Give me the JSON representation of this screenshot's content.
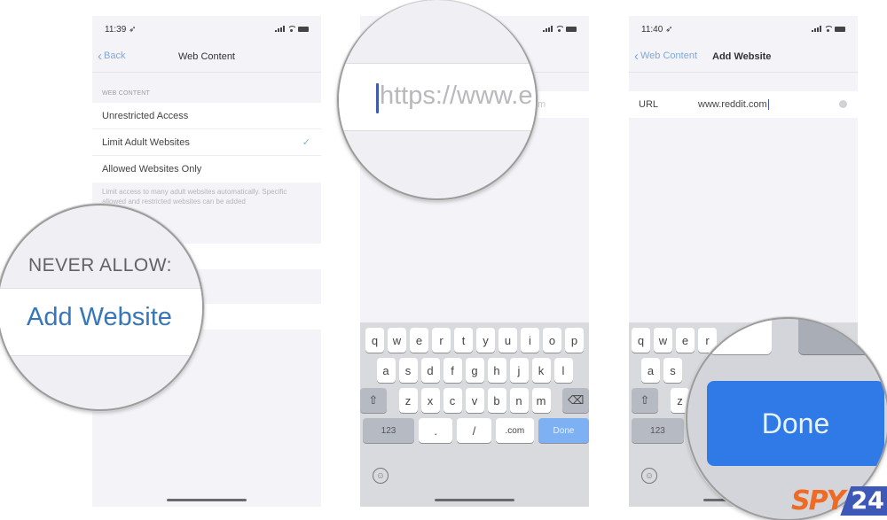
{
  "screens": [
    {
      "status": {
        "time": "11:39",
        "location_icon": "location-arrow-icon"
      },
      "nav": {
        "back_label": "Back",
        "title": "Web Content"
      },
      "section_header": "WEB CONTENT",
      "options": [
        {
          "label": "Unrestricted Access",
          "selected": false
        },
        {
          "label": "Limit Adult Websites",
          "selected": true
        },
        {
          "label": "Allowed Websites Only",
          "selected": false
        }
      ],
      "check_glyph": "✓",
      "footer": "Limit access to many adult websites automatically. Specific allowed and restricted websites can be added",
      "magnifier": {
        "header": "NEVER ALLOW:",
        "action": "Add Website"
      }
    },
    {
      "url_ghost": "m",
      "magnifier": {
        "placeholder": "https://www.e"
      },
      "keyboard": {
        "row1": [
          "q",
          "w",
          "e",
          "r",
          "t",
          "y",
          "u",
          "i",
          "o",
          "p"
        ],
        "row2": [
          "a",
          "s",
          "d",
          "f",
          "g",
          "h",
          "j",
          "k",
          "l"
        ],
        "row3": [
          "z",
          "x",
          "c",
          "v",
          "b",
          "n",
          "m"
        ],
        "shift_glyph": "⇧",
        "delete_glyph": "⌫",
        "numbers_label": "123",
        "dot_label": ".",
        "slash_label": "/",
        "com_label": ".com",
        "done_label": "Done",
        "emoji_glyph": "☺"
      }
    },
    {
      "status": {
        "time": "11:40"
      },
      "nav": {
        "back_label": "Web Content",
        "title": "Add Website"
      },
      "url_field": {
        "label": "URL",
        "value": "www.reddit.com"
      },
      "keyboard": {
        "row1": [
          "q",
          "w",
          "e",
          "r"
        ],
        "row2": [
          "a",
          "s"
        ],
        "row3": [
          "z"
        ],
        "shift_glyph": "⇧",
        "numbers_label": "123",
        "emoji_glyph": "☺"
      },
      "magnifier": {
        "done_label": "Done"
      }
    }
  ],
  "logo": {
    "part1": "SPY",
    "part2": "24"
  },
  "colors": {
    "ios_blue": "#3776b8",
    "done_blue": "#2f7ae6",
    "logo_orange": "#ef6a22",
    "logo_blue": "#3e58b8"
  }
}
